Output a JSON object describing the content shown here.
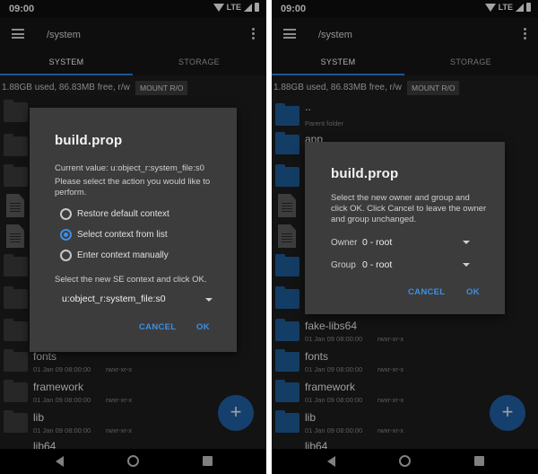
{
  "colors": {
    "accent": "#3d8fe3",
    "fab": "#1f5fa3",
    "folder_blue": "#1d5a96",
    "background": "#1c1c1c",
    "dialog": "#3c3c3c"
  },
  "left": {
    "status": {
      "time": "09:00",
      "network": "LTE"
    },
    "toolbar": {
      "path": "/system",
      "menu_icon": "menu-icon",
      "overflow_icon": "more-vert-icon"
    },
    "tabs": [
      "SYSTEM",
      "STORAGE"
    ],
    "info": {
      "text": "1.88GB used, 86.83MB free, r/w",
      "mount_label": "MOUNT R/O"
    },
    "rows": [
      {
        "name": "fonts",
        "date": "01 Jan 09 08:00:00",
        "perm": "rwxr-xr-x"
      },
      {
        "name": "framework",
        "date": "01 Jan 09 08:00:00",
        "perm": "rwxr-xr-x"
      },
      {
        "name": "lib",
        "date": "01 Jan 09 08:00:00",
        "perm": "rwxr-xr-x"
      },
      {
        "name": "lib64"
      }
    ],
    "dialog": {
      "title": "build.prop",
      "current_value": "Current value: u:object_r:system_file:s0",
      "instruction": "Please select the action you would like to perform.",
      "options": [
        {
          "label": "Restore default context",
          "checked": false
        },
        {
          "label": "Select context from list",
          "checked": true
        },
        {
          "label": "Enter context manually",
          "checked": false
        }
      ],
      "select_prompt": "Select the new SE context and click OK.",
      "selected_context": "u:object_r:system_file:s0",
      "cancel_label": "CANCEL",
      "ok_label": "OK"
    },
    "fab_label": "+"
  },
  "right": {
    "status": {
      "time": "09:00",
      "network": "LTE"
    },
    "toolbar": {
      "path": "/system"
    },
    "tabs": [
      "SYSTEM",
      "STORAGE"
    ],
    "info": {
      "text": "1.88GB used, 86.83MB free, r/w",
      "mount_label": "MOUNT R/O"
    },
    "parent": {
      "name": "..",
      "sub": "Parent folder"
    },
    "rows": [
      {
        "name": "app"
      },
      {
        "name": "fake-libs64",
        "date": "01 Jan 09 08:00:00",
        "perm": "rwxr-xr-x"
      },
      {
        "name": "fonts",
        "date": "01 Jan 09 08:00:00",
        "perm": "rwxr-xr-x"
      },
      {
        "name": "framework",
        "date": "01 Jan 09 08:00:00",
        "perm": "rwxr-xr-x"
      },
      {
        "name": "lib",
        "date": "01 Jan 09 08:00:00",
        "perm": "rwxr-xr-x"
      },
      {
        "name": "lib64"
      }
    ],
    "dialog": {
      "title": "build.prop",
      "instruction": "Select the new owner and group and click OK. Click Cancel to leave the owner and group unchanged.",
      "owner_label": "Owner",
      "owner_value": "0 - root",
      "group_label": "Group",
      "group_value": "0 - root",
      "cancel_label": "CANCEL",
      "ok_label": "OK"
    },
    "fab_label": "+"
  }
}
